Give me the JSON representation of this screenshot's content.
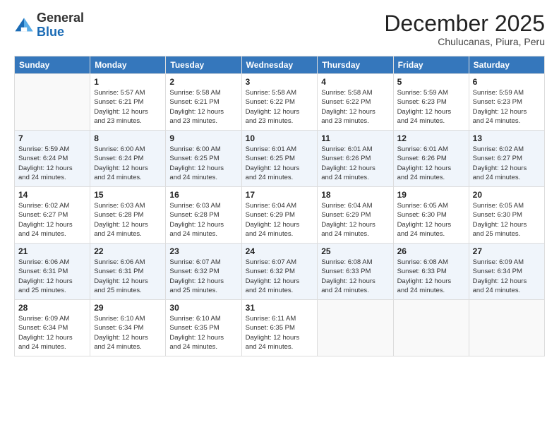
{
  "header": {
    "logo_line1": "General",
    "logo_line2": "Blue",
    "month": "December 2025",
    "location": "Chulucanas, Piura, Peru"
  },
  "weekdays": [
    "Sunday",
    "Monday",
    "Tuesday",
    "Wednesday",
    "Thursday",
    "Friday",
    "Saturday"
  ],
  "weeks": [
    [
      {
        "day": "",
        "info": ""
      },
      {
        "day": "1",
        "info": "Sunrise: 5:57 AM\nSunset: 6:21 PM\nDaylight: 12 hours\nand 23 minutes."
      },
      {
        "day": "2",
        "info": "Sunrise: 5:58 AM\nSunset: 6:21 PM\nDaylight: 12 hours\nand 23 minutes."
      },
      {
        "day": "3",
        "info": "Sunrise: 5:58 AM\nSunset: 6:22 PM\nDaylight: 12 hours\nand 23 minutes."
      },
      {
        "day": "4",
        "info": "Sunrise: 5:58 AM\nSunset: 6:22 PM\nDaylight: 12 hours\nand 23 minutes."
      },
      {
        "day": "5",
        "info": "Sunrise: 5:59 AM\nSunset: 6:23 PM\nDaylight: 12 hours\nand 24 minutes."
      },
      {
        "day": "6",
        "info": "Sunrise: 5:59 AM\nSunset: 6:23 PM\nDaylight: 12 hours\nand 24 minutes."
      }
    ],
    [
      {
        "day": "7",
        "info": "Sunrise: 5:59 AM\nSunset: 6:24 PM\nDaylight: 12 hours\nand 24 minutes."
      },
      {
        "day": "8",
        "info": "Sunrise: 6:00 AM\nSunset: 6:24 PM\nDaylight: 12 hours\nand 24 minutes."
      },
      {
        "day": "9",
        "info": "Sunrise: 6:00 AM\nSunset: 6:25 PM\nDaylight: 12 hours\nand 24 minutes."
      },
      {
        "day": "10",
        "info": "Sunrise: 6:01 AM\nSunset: 6:25 PM\nDaylight: 12 hours\nand 24 minutes."
      },
      {
        "day": "11",
        "info": "Sunrise: 6:01 AM\nSunset: 6:26 PM\nDaylight: 12 hours\nand 24 minutes."
      },
      {
        "day": "12",
        "info": "Sunrise: 6:01 AM\nSunset: 6:26 PM\nDaylight: 12 hours\nand 24 minutes."
      },
      {
        "day": "13",
        "info": "Sunrise: 6:02 AM\nSunset: 6:27 PM\nDaylight: 12 hours\nand 24 minutes."
      }
    ],
    [
      {
        "day": "14",
        "info": "Sunrise: 6:02 AM\nSunset: 6:27 PM\nDaylight: 12 hours\nand 24 minutes."
      },
      {
        "day": "15",
        "info": "Sunrise: 6:03 AM\nSunset: 6:28 PM\nDaylight: 12 hours\nand 24 minutes."
      },
      {
        "day": "16",
        "info": "Sunrise: 6:03 AM\nSunset: 6:28 PM\nDaylight: 12 hours\nand 24 minutes."
      },
      {
        "day": "17",
        "info": "Sunrise: 6:04 AM\nSunset: 6:29 PM\nDaylight: 12 hours\nand 24 minutes."
      },
      {
        "day": "18",
        "info": "Sunrise: 6:04 AM\nSunset: 6:29 PM\nDaylight: 12 hours\nand 24 minutes."
      },
      {
        "day": "19",
        "info": "Sunrise: 6:05 AM\nSunset: 6:30 PM\nDaylight: 12 hours\nand 24 minutes."
      },
      {
        "day": "20",
        "info": "Sunrise: 6:05 AM\nSunset: 6:30 PM\nDaylight: 12 hours\nand 25 minutes."
      }
    ],
    [
      {
        "day": "21",
        "info": "Sunrise: 6:06 AM\nSunset: 6:31 PM\nDaylight: 12 hours\nand 25 minutes."
      },
      {
        "day": "22",
        "info": "Sunrise: 6:06 AM\nSunset: 6:31 PM\nDaylight: 12 hours\nand 25 minutes."
      },
      {
        "day": "23",
        "info": "Sunrise: 6:07 AM\nSunset: 6:32 PM\nDaylight: 12 hours\nand 25 minutes."
      },
      {
        "day": "24",
        "info": "Sunrise: 6:07 AM\nSunset: 6:32 PM\nDaylight: 12 hours\nand 24 minutes."
      },
      {
        "day": "25",
        "info": "Sunrise: 6:08 AM\nSunset: 6:33 PM\nDaylight: 12 hours\nand 24 minutes."
      },
      {
        "day": "26",
        "info": "Sunrise: 6:08 AM\nSunset: 6:33 PM\nDaylight: 12 hours\nand 24 minutes."
      },
      {
        "day": "27",
        "info": "Sunrise: 6:09 AM\nSunset: 6:34 PM\nDaylight: 12 hours\nand 24 minutes."
      }
    ],
    [
      {
        "day": "28",
        "info": "Sunrise: 6:09 AM\nSunset: 6:34 PM\nDaylight: 12 hours\nand 24 minutes."
      },
      {
        "day": "29",
        "info": "Sunrise: 6:10 AM\nSunset: 6:34 PM\nDaylight: 12 hours\nand 24 minutes."
      },
      {
        "day": "30",
        "info": "Sunrise: 6:10 AM\nSunset: 6:35 PM\nDaylight: 12 hours\nand 24 minutes."
      },
      {
        "day": "31",
        "info": "Sunrise: 6:11 AM\nSunset: 6:35 PM\nDaylight: 12 hours\nand 24 minutes."
      },
      {
        "day": "",
        "info": ""
      },
      {
        "day": "",
        "info": ""
      },
      {
        "day": "",
        "info": ""
      }
    ]
  ]
}
